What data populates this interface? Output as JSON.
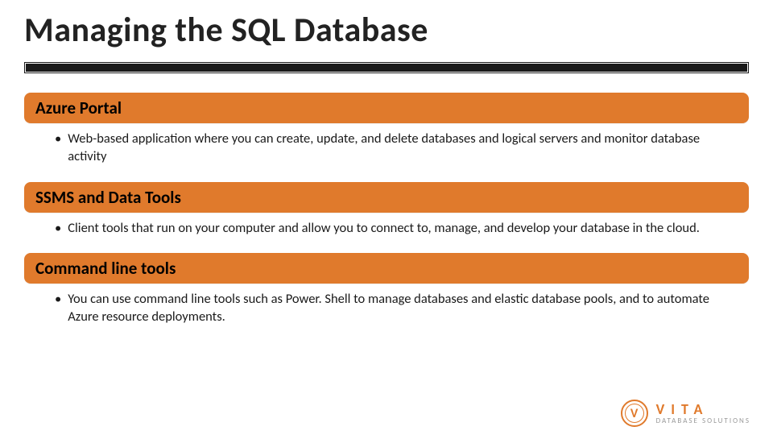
{
  "title": "Managing the SQL Database",
  "sections": [
    {
      "heading": "Azure Portal",
      "bullet": "Web-based application where you can create, update, and delete databases and logical servers and monitor database activity"
    },
    {
      "heading": "SSMS and Data Tools",
      "bullet": "Client tools that run on your computer and allow you to connect to, manage, and develop your database in the cloud."
    },
    {
      "heading": "Command line tools",
      "bullet": "You can use command line tools such as Power. Shell to manage databases and elastic database pools, and to automate Azure resource deployments."
    }
  ],
  "footer": {
    "brand": "VITA",
    "tagline": "DATABASE SOLUTIONS",
    "icon_letter": "V"
  }
}
